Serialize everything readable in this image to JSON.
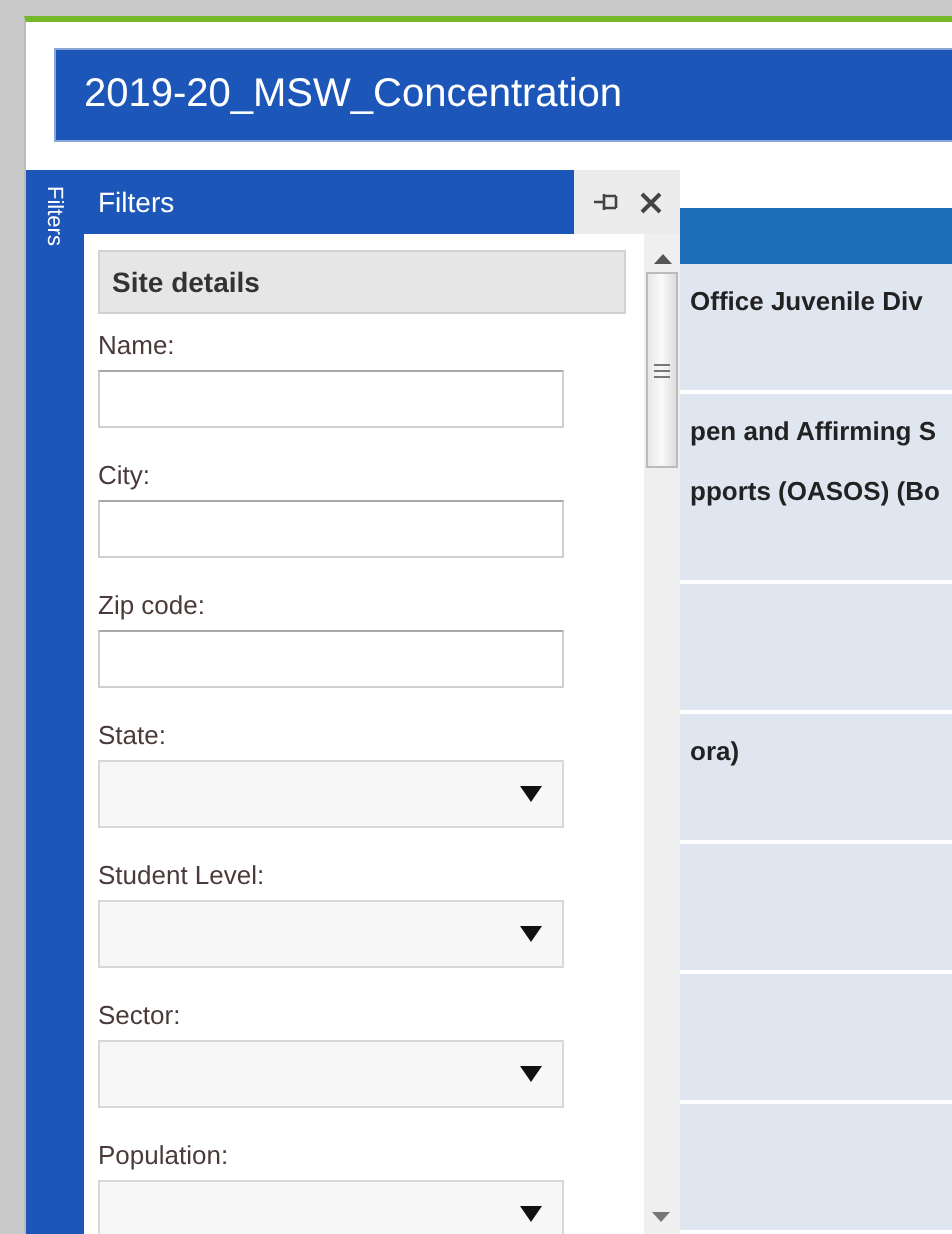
{
  "window": {
    "title": "2019-20_MSW_Concentration"
  },
  "side_tab": {
    "label": "Filters"
  },
  "filter_panel": {
    "title": "Filters",
    "section": "Site details",
    "fields": [
      {
        "kind": "text",
        "label": "Name:"
      },
      {
        "kind": "text",
        "label": "City:"
      },
      {
        "kind": "text",
        "label": "Zip code:"
      },
      {
        "kind": "dropdown",
        "label": "State:"
      },
      {
        "kind": "dropdown",
        "label": "Student Level:"
      },
      {
        "kind": "dropdown",
        "label": "Sector:"
      },
      {
        "kind": "dropdown",
        "label": "Population:"
      }
    ]
  },
  "grid": {
    "rows": [
      {
        "kind": "text",
        "lines": [
          "Office Juvenile Div"
        ]
      },
      {
        "kind": "text",
        "lines": [
          "pen and Affirming S",
          "pports (OASOS) (Bo"
        ]
      },
      {
        "kind": "empty"
      },
      {
        "kind": "text",
        "lines": [
          "ora)"
        ]
      },
      {
        "kind": "empty"
      },
      {
        "kind": "empty"
      },
      {
        "kind": "empty"
      }
    ]
  }
}
